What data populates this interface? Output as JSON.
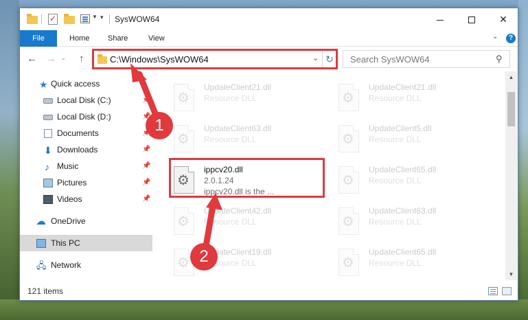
{
  "window": {
    "title": "SysWOW64",
    "quick_access_toolbar": {
      "icons": [
        "folder-icon",
        "properties-icon",
        "new-folder-icon",
        "view-icon"
      ],
      "customize": "▾"
    },
    "controls": {
      "minimize": "minimize",
      "maximize": "maximize",
      "close": "✕"
    }
  },
  "ribbon": {
    "tabs": [
      {
        "label": "File",
        "active": true
      },
      {
        "label": "Home"
      },
      {
        "label": "Share"
      },
      {
        "label": "View"
      }
    ],
    "expand_icon": "⌄",
    "help_icon": "?"
  },
  "navigation": {
    "back": "←",
    "forward": "→",
    "recent": "⌄",
    "up": "↑",
    "address": "C:\\Windows\\SysWOW64",
    "address_dropdown": "⌄",
    "refresh": "↻",
    "search_placeholder": "Search SysWOW64",
    "search_icon": "⚲"
  },
  "nav_pane": {
    "items": [
      {
        "label": "Quick access",
        "icon": "star-icon",
        "pinned": false
      },
      {
        "label": "Local Disk (C:)",
        "icon": "drive-icon",
        "pinned": true
      },
      {
        "label": "Local Disk (D:)",
        "icon": "drive-icon",
        "pinned": true
      },
      {
        "label": "Documents",
        "icon": "documents-icon",
        "pinned": true
      },
      {
        "label": "Downloads",
        "icon": "download-icon",
        "pinned": true
      },
      {
        "label": "Music",
        "icon": "music-icon",
        "pinned": true
      },
      {
        "label": "Pictures",
        "icon": "pictures-icon",
        "pinned": true
      },
      {
        "label": "Videos",
        "icon": "videos-icon",
        "pinned": true
      },
      {
        "label": "OneDrive",
        "icon": "cloud-icon",
        "pinned": false
      },
      {
        "label": "This PC",
        "icon": "computer-icon",
        "pinned": false,
        "selected": true
      },
      {
        "label": "Network",
        "icon": "network-icon",
        "pinned": false
      }
    ],
    "pin_glyph": "📌"
  },
  "files": [
    {
      "name": "UpdateClient21.dll",
      "detail": "Resource DLL",
      "faded": true
    },
    {
      "name": "UpdateClient21.dll",
      "detail": "Resource DLL",
      "faded": true
    },
    {
      "name": "UpdateClient63.dll",
      "detail": "Resource DLL",
      "faded": true
    },
    {
      "name": "UpdateClient5.dll",
      "detail": "Resource DLL",
      "faded": true
    },
    {
      "name": "ippcv20.dll",
      "detail": "2.0.1.24",
      "description": "ippcv20.dll is the ...",
      "faded": false
    },
    {
      "name": "UpdateClient65.dll",
      "detail": "Resource DLL",
      "faded": true
    },
    {
      "name": "UpdateClient42.dll",
      "detail": "Resource DLL",
      "faded": true
    },
    {
      "name": "UpdateClient63.dll",
      "detail": "Resource DLL",
      "faded": true
    },
    {
      "name": "UpdateClient19.dll",
      "detail": "Resource DLL",
      "faded": true
    },
    {
      "name": "UpdateClient65.dll",
      "detail": "Resource DLL",
      "faded": true
    }
  ],
  "status": {
    "item_count": "121 items"
  },
  "annotations": {
    "step1": "1",
    "step2": "2",
    "color": "#e0393e"
  },
  "colors": {
    "accent": "#1979ca",
    "highlight": "#e0393e"
  }
}
